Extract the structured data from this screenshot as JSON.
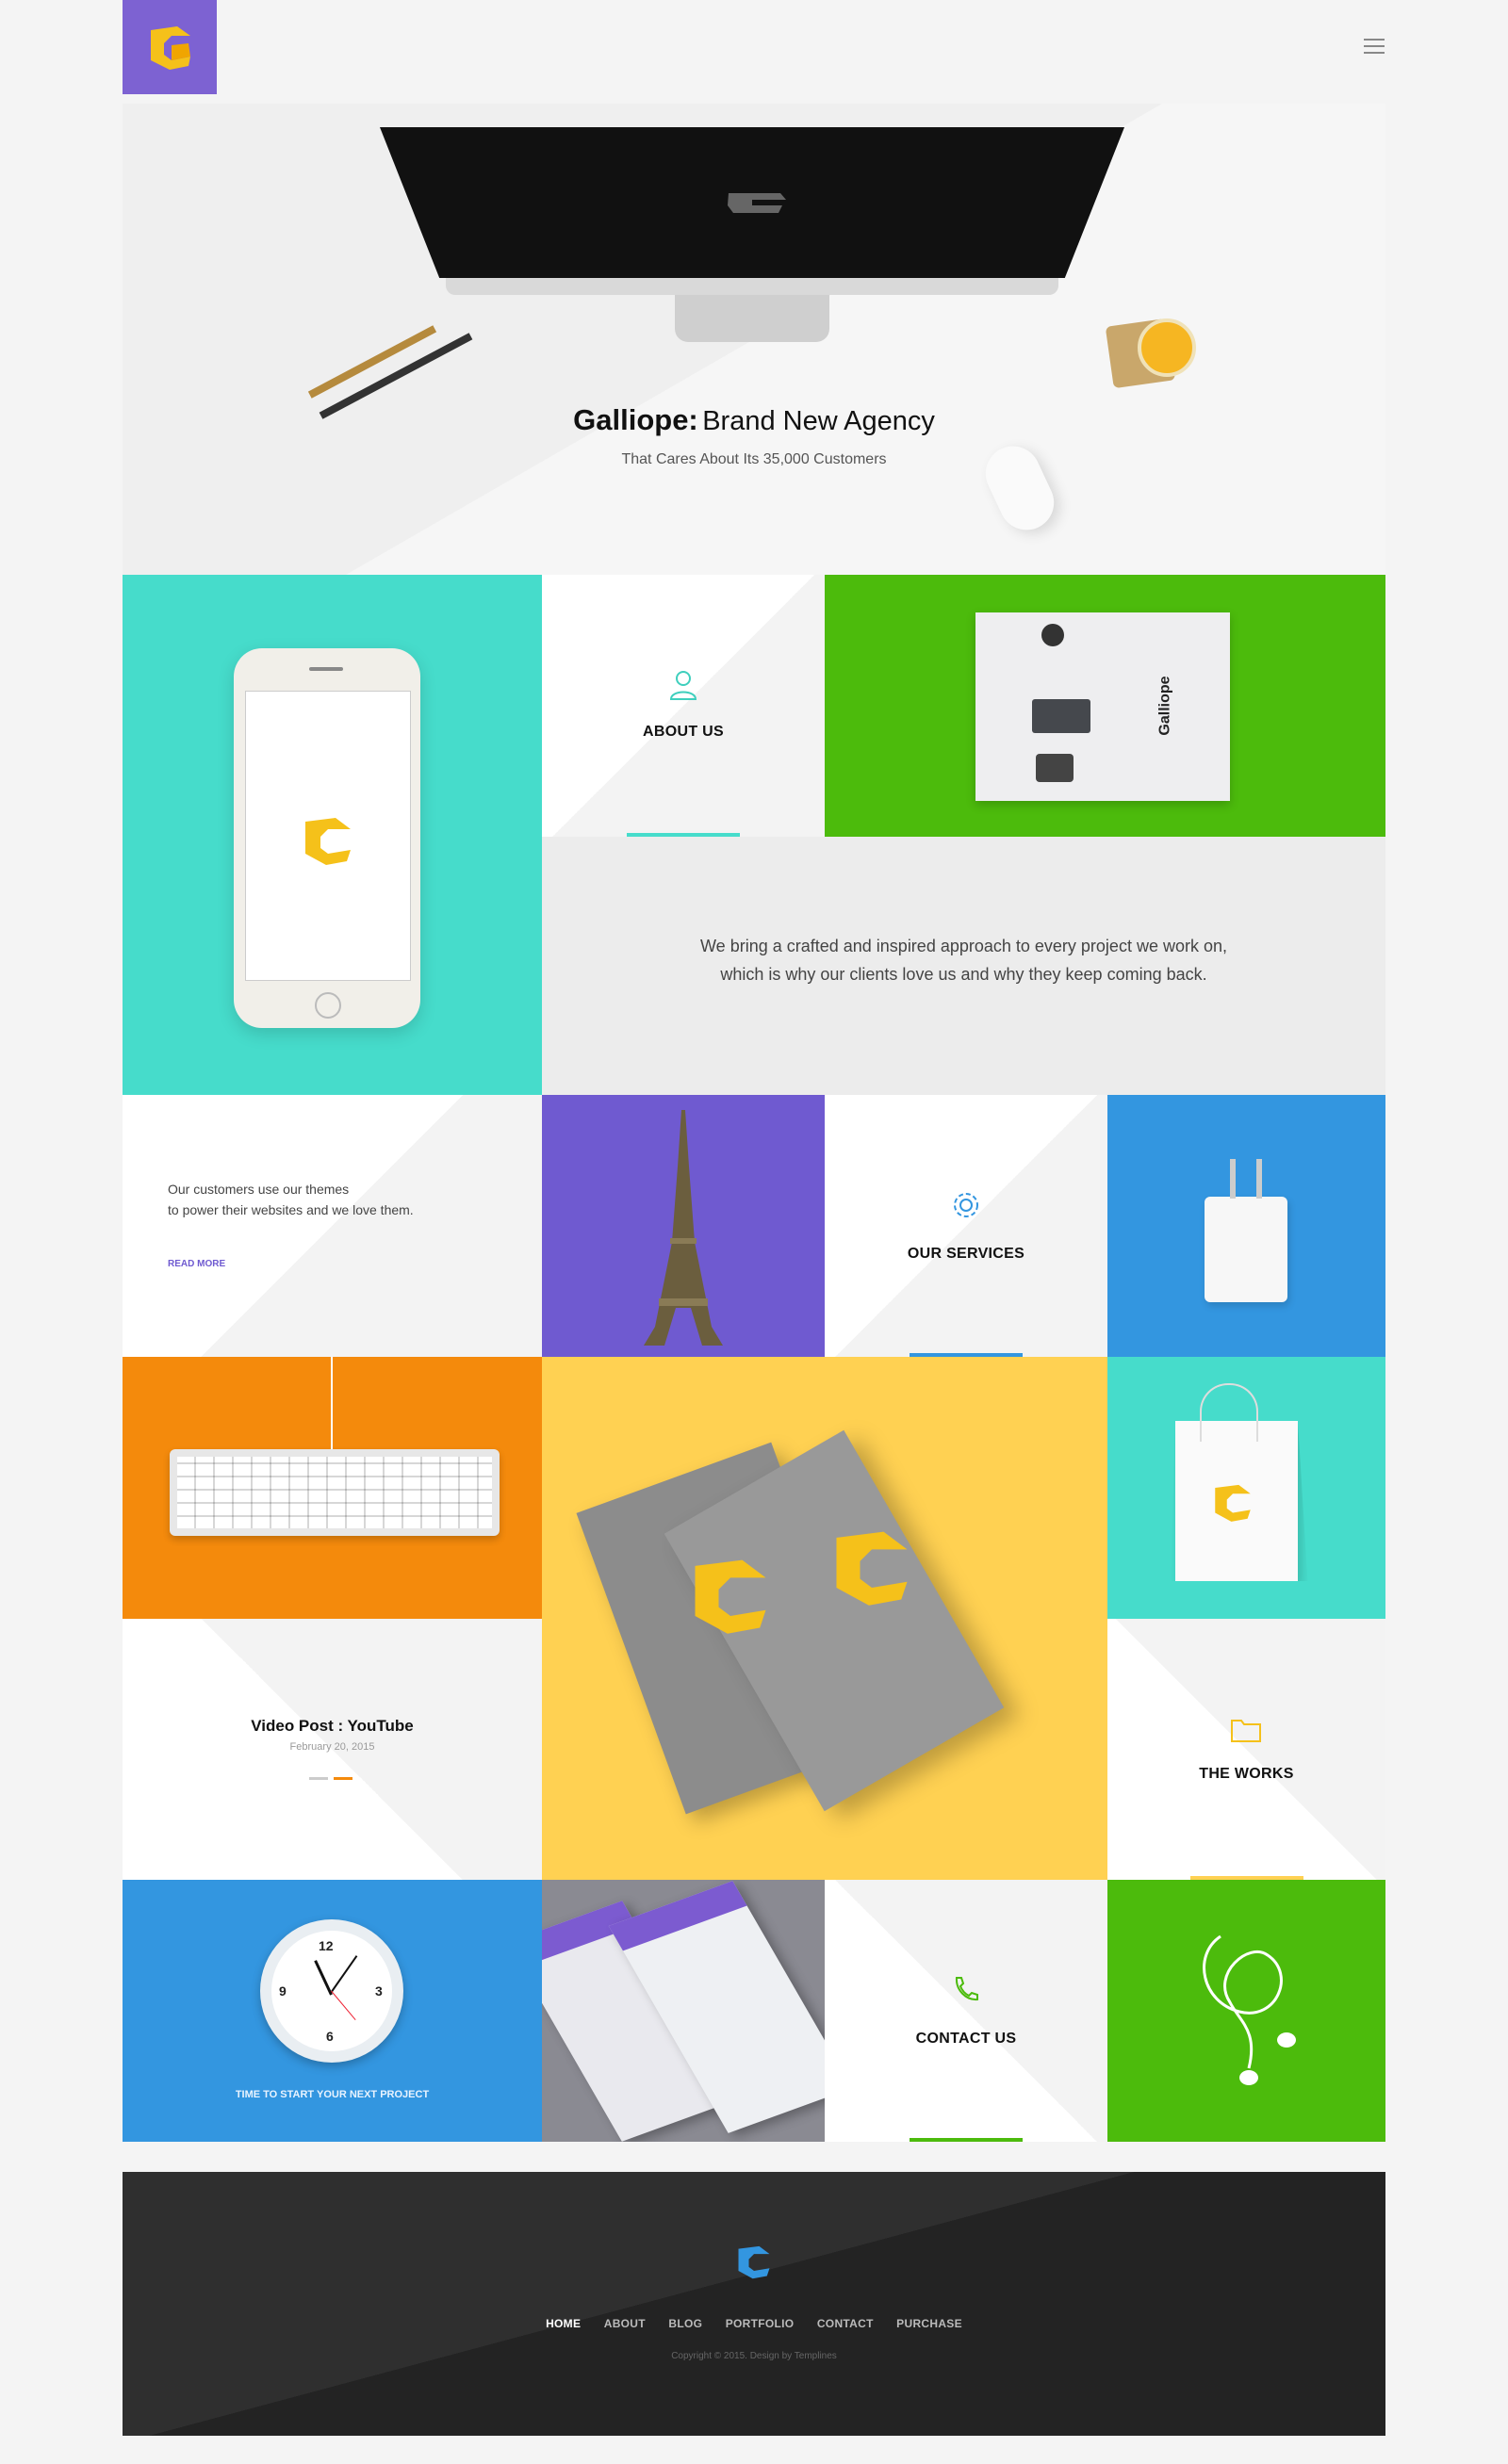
{
  "header": {
    "logo_alt": "Galliope logo",
    "menu_icon": "hamburger-menu-icon"
  },
  "hero": {
    "title_brand": "Galliope:",
    "title_rest": "Brand New Agency",
    "subtitle": "That Cares About Its 35,000 Customers"
  },
  "about": {
    "label": "ABOUT US",
    "icon": "user-icon",
    "text_line1": "We bring a crafted and inspired approach to every project we work on,",
    "text_line2": "which is why our clients love us and why they keep coming back.",
    "card_text": "Galliope"
  },
  "testimonial": {
    "line1": "Our customers use our themes",
    "line2": "to power their websites and we love them.",
    "read_more": "READ MORE"
  },
  "services": {
    "label": "OUR SERVICES",
    "icon": "gear-icon"
  },
  "video_post": {
    "title": "Video Post : YouTube",
    "date": "February 20, 2015"
  },
  "works": {
    "label": "THE WORKS",
    "icon": "folder-icon"
  },
  "clock": {
    "numbers": [
      "12",
      "3",
      "6",
      "9"
    ],
    "caption": "TIME TO START YOUR NEXT PROJECT"
  },
  "contact": {
    "label": "CONTACT US",
    "icon": "phone-icon"
  },
  "footer": {
    "nav": [
      "HOME",
      "ABOUT",
      "BLOG",
      "PORTFOLIO",
      "CONTACT",
      "PURCHASE"
    ],
    "copyright": "Copyright © 2015. Design by Templines"
  },
  "colors": {
    "purple": "#6f5ad0",
    "teal": "#46dccb",
    "green": "#4cbb0c",
    "blue": "#3396e0",
    "orange": "#f48a0c",
    "yellow": "#ffd152",
    "dark": "#262626"
  }
}
